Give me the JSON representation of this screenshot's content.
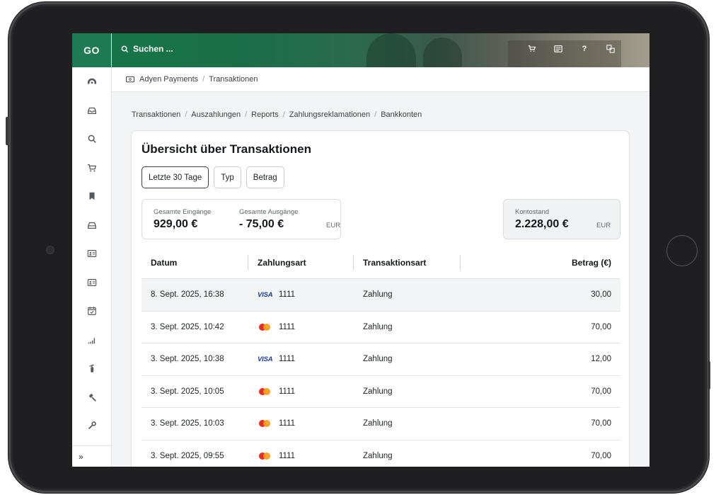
{
  "sidebar": {
    "logo": "GO",
    "collapse_label": "»"
  },
  "topbar": {
    "search_placeholder": "Suchen ...",
    "icons": [
      "cart-icon",
      "list-icon",
      "help-icon",
      "translate-icon"
    ],
    "help_label": "?"
  },
  "breadcrumb": {
    "app": "Adyen Payments",
    "page": "Transaktionen"
  },
  "subnav": [
    "Transaktionen",
    "Auszahlungen",
    "Reports",
    "Zahlungsreklamationen",
    "Bankkonten"
  ],
  "main": {
    "title": "Übersicht über Transaktionen",
    "filters": [
      "Letzte 30 Tage",
      "Typ",
      "Betrag"
    ],
    "stats": {
      "income_label": "Gesamte Eingänge",
      "income_value": "929,00 €",
      "expense_label": "Gesamte Ausgänge",
      "expense_value": "- 75,00 €",
      "currency": "EUR",
      "balance_label": "Kontostand",
      "balance_value": "2.228,00 €",
      "balance_currency": "EUR"
    },
    "table": {
      "headers": [
        "Datum",
        "Zahlungsart",
        "Transaktionsart",
        "Betrag (€)"
      ],
      "rows": [
        {
          "date": "8. Sept. 2025, 16:38",
          "brand": "visa",
          "brand_label": "VISA",
          "card": "1111",
          "type": "Zahlung",
          "amount": "30,00"
        },
        {
          "date": "3. Sept. 2025, 10:42",
          "brand": "mastercard",
          "brand_label": "",
          "card": "1111",
          "type": "Zahlung",
          "amount": "70,00"
        },
        {
          "date": "3. Sept. 2025, 10:38",
          "brand": "visa",
          "brand_label": "VISA",
          "card": "1111",
          "type": "Zahlung",
          "amount": "12,00"
        },
        {
          "date": "3. Sept. 2025, 10:05",
          "brand": "mastercard",
          "brand_label": "",
          "card": "1111",
          "type": "Zahlung",
          "amount": "70,00"
        },
        {
          "date": "3. Sept. 2025, 10:03",
          "brand": "mastercard",
          "brand_label": "",
          "card": "1111",
          "type": "Zahlung",
          "amount": "70,00"
        },
        {
          "date": "3. Sept. 2025, 09:55",
          "brand": "mastercard",
          "brand_label": "",
          "card": "1111",
          "type": "Zahlung",
          "amount": "70,00"
        }
      ]
    }
  },
  "colors": {
    "brand_green": "#1d7a52",
    "visa_blue": "#1a3d96",
    "mc_red": "#eb2b1f",
    "mc_orange": "#f79e1b"
  }
}
